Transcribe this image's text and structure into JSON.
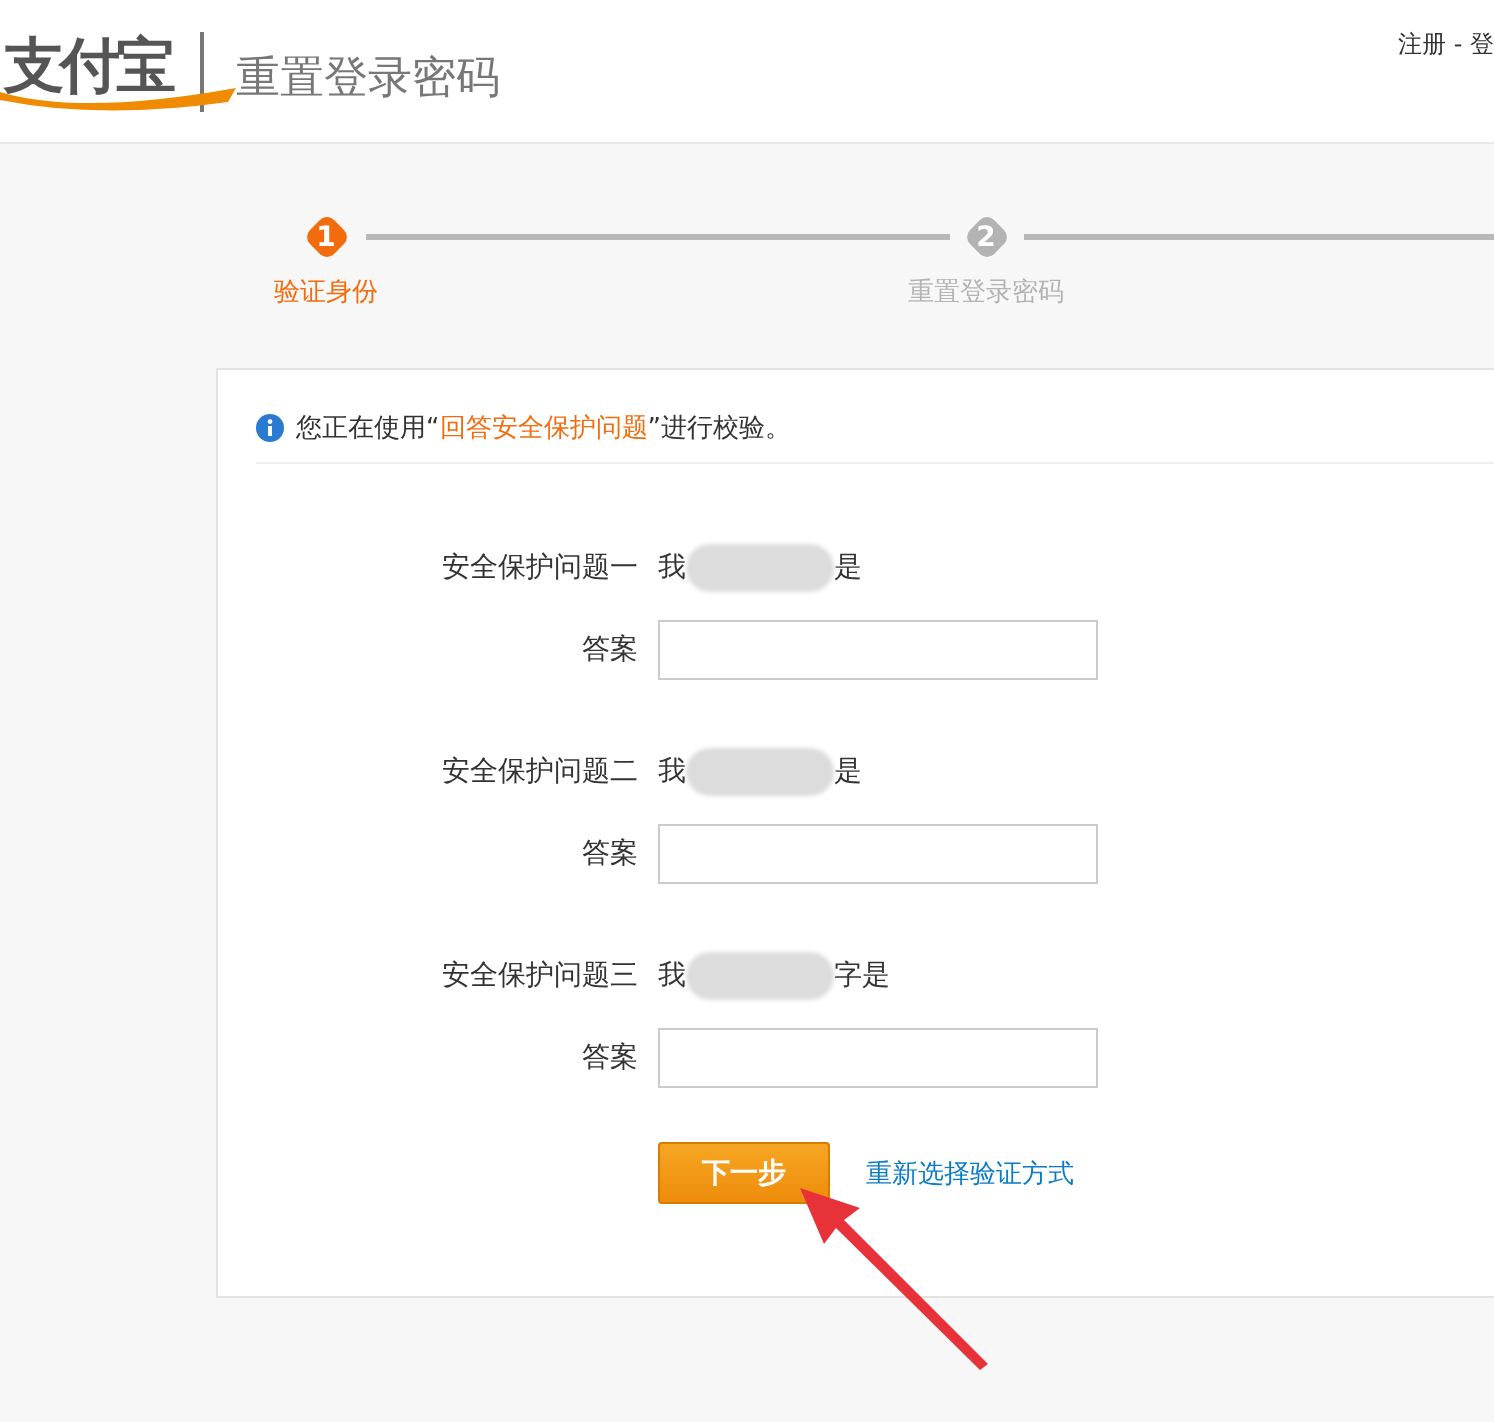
{
  "header": {
    "logo": "支付宝",
    "title": "重置登录密码",
    "links": "注册 - 登"
  },
  "steps": [
    {
      "number": "1",
      "label": "验证身份",
      "selected": true
    },
    {
      "number": "2",
      "label": "重置登录密码",
      "selected": false
    }
  ],
  "notice": {
    "text": "您正在使用“**回答安全保护问题**”进行校验。"
  },
  "questions": [
    {
      "label": "安全保护问题一",
      "question_start": "我",
      "question_end": "是",
      "answer_label": "答案"
    },
    {
      "label": "安全保护问题二",
      "question_start": "我",
      "question_end": "是",
      "answer_label": "答案"
    },
    {
      "label": "安全保护问题三",
      "question_start": "我",
      "question_end": "字是",
      "answer_label": "答案"
    }
  ],
  "next_button": "下一步",
  "change_method_link": "重新选择验证方式"
}
